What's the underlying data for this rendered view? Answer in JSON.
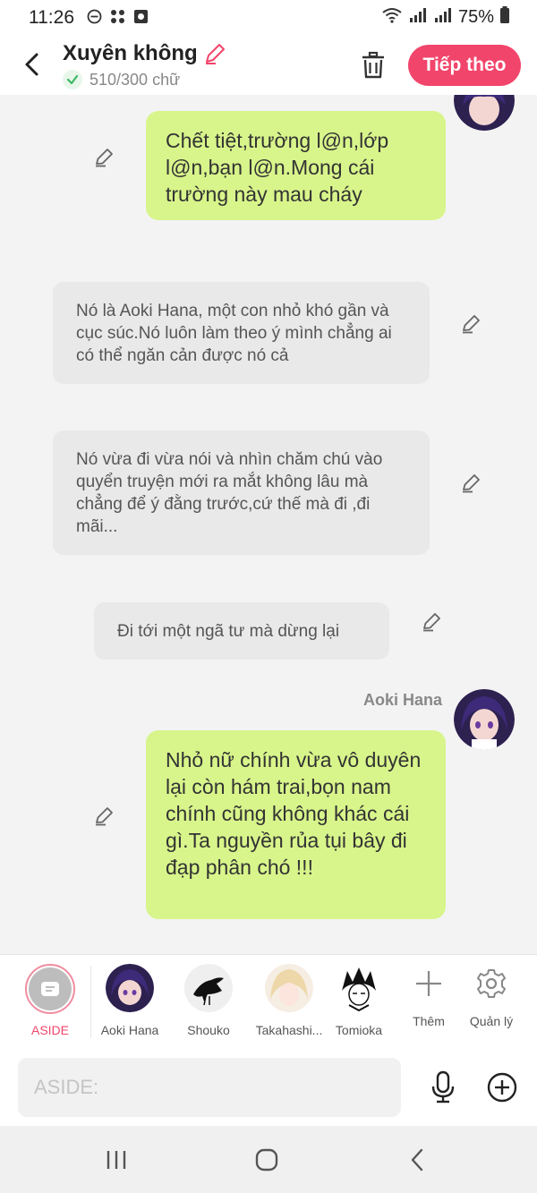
{
  "status": {
    "time": "11:26",
    "battery": "75%"
  },
  "header": {
    "title": "Xuyên không",
    "word_count": "510/300 chữ",
    "next_label": "Tiếp theo"
  },
  "messages": [
    {
      "type": "narration_right",
      "text": "Chết tiệt,trường l@n,lớp l@n,bạn l@n.Mong cái trường này mau cháy"
    },
    {
      "type": "aside",
      "text": "Nó là Aoki Hana, một con nhỏ khó gần và cục súc.Nó luôn làm theo ý mình chẳng ai có thể ngăn cản được nó cả"
    },
    {
      "type": "aside",
      "text": "Nó vừa đi vừa nói và nhìn chăm chú vào quyển truyện mới ra mắt không lâu mà chẳng để ý đằng trước,cứ thế mà đi ,đi mãi..."
    },
    {
      "type": "aside",
      "text": "Đi tới một ngã tư mà dừng lại"
    },
    {
      "type": "speech",
      "speaker": "Aoki Hana",
      "text": "Nhỏ nữ chính vừa vô duyên lại còn hám trai,bọn nam chính cũng không khác cái gì.Ta nguyền rủa tụi bây đi đạp phân chó !!!"
    }
  ],
  "characters": [
    {
      "name": "ASIDE",
      "selected": true
    },
    {
      "name": "Aoki Hana"
    },
    {
      "name": "Shouko"
    },
    {
      "name": "Takahashi..."
    },
    {
      "name": "Tomioka"
    }
  ],
  "actions": {
    "add_label": "Thêm",
    "manage_label": "Quản lý"
  },
  "input": {
    "placeholder": "ASIDE:"
  },
  "colors": {
    "accent": "#f2456b",
    "bubble_green": "#d8f58b",
    "bubble_gray": "#e9e9e9"
  }
}
